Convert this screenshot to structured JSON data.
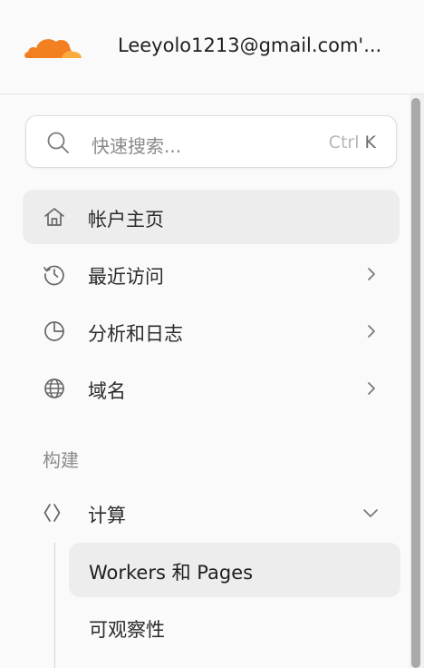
{
  "header": {
    "account": "Leeyolo1213@gmail.com'..."
  },
  "search": {
    "placeholder": "快速搜索...",
    "shortcut_ctrl": "Ctrl",
    "shortcut_key": "K"
  },
  "nav": {
    "items": [
      {
        "label": "帐户主页",
        "icon": "home-icon"
      },
      {
        "label": "最近访问",
        "icon": "history-icon"
      },
      {
        "label": "分析和日志",
        "icon": "pie-chart-icon"
      },
      {
        "label": "域名",
        "icon": "globe-icon"
      }
    ],
    "section_build": "构建",
    "compute": {
      "label": "计算",
      "icon": "code-brackets-icon"
    },
    "sub_items": [
      {
        "label": "Workers 和 Pages"
      },
      {
        "label": "可观察性"
      }
    ]
  },
  "colors": {
    "brand_orange": "#f38020",
    "brand_orange_light": "#faad3f",
    "active_bg": "#ededed"
  }
}
